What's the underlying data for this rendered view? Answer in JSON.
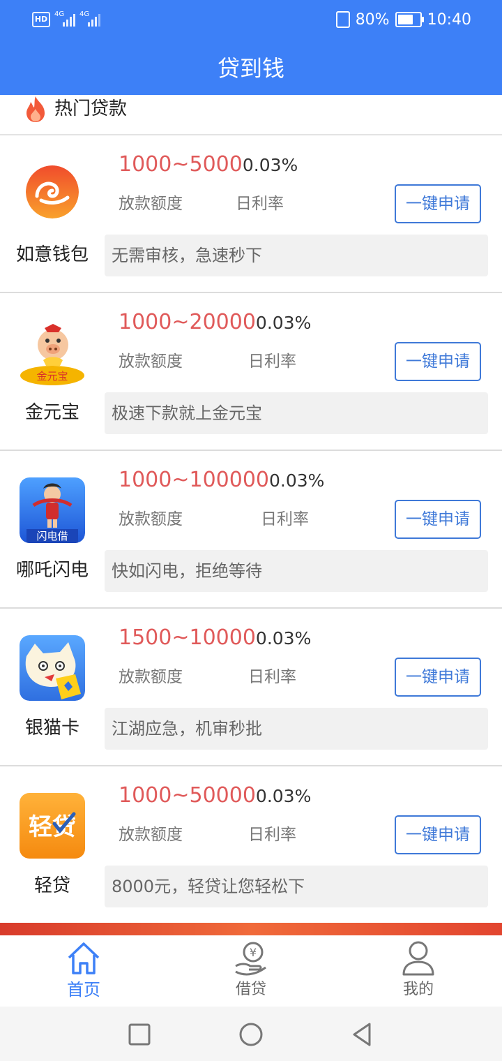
{
  "status_bar": {
    "hd": "HD",
    "net1": "4G",
    "net2": "4G",
    "battery_percent": "80%",
    "time": "10:40"
  },
  "header": {
    "title": "贷到钱"
  },
  "section": {
    "title": "热门贷款"
  },
  "loans": [
    {
      "name": "如意钱包",
      "range": "1000~5000",
      "rate": "0.03%",
      "amount_label": "放款额度",
      "rate_label": "日利率",
      "apply_label": "一键申请",
      "slogan": "无需审核，急速秒下",
      "logo_icon": "ruyi-cloud-icon"
    },
    {
      "name": "金元宝",
      "range": "1000~20000",
      "rate": "0.03%",
      "amount_label": "放款额度",
      "rate_label": "日利率",
      "apply_label": "一键申请",
      "slogan": "极速下款就上金元宝",
      "logo_icon": "piggy-gold-icon",
      "logo_text": "金元宝"
    },
    {
      "name": "哪吒闪电",
      "range": "1000~100000",
      "rate": "0.03%",
      "amount_label": "放款额度",
      "rate_label": "日利率",
      "apply_label": "一键申请",
      "slogan": "快如闪电，拒绝等待",
      "logo_icon": "nezha-icon",
      "logo_text": "闪电借"
    },
    {
      "name": "银猫卡",
      "range": "1500~10000",
      "rate": "0.03%",
      "amount_label": "放款额度",
      "rate_label": "日利率",
      "apply_label": "一键申请",
      "slogan": "江湖应急，机审秒批",
      "logo_icon": "cat-icon"
    },
    {
      "name": "轻贷",
      "range": "1000~50000",
      "rate": "0.03%",
      "amount_label": "放款额度",
      "rate_label": "日利率",
      "apply_label": "一键申请",
      "slogan": "8000元，轻贷让您轻松下",
      "logo_icon": "qingdai-icon",
      "logo_text": "轻贷"
    }
  ],
  "bottom_nav": [
    {
      "label": "首页",
      "icon": "home-icon",
      "active": true
    },
    {
      "label": "借贷",
      "icon": "yen-hand-icon",
      "active": false
    },
    {
      "label": "我的",
      "icon": "user-icon",
      "active": false
    }
  ],
  "colors": {
    "primary": "#3d80f7",
    "amount": "#e05a5a",
    "button": "#3f79d8"
  }
}
